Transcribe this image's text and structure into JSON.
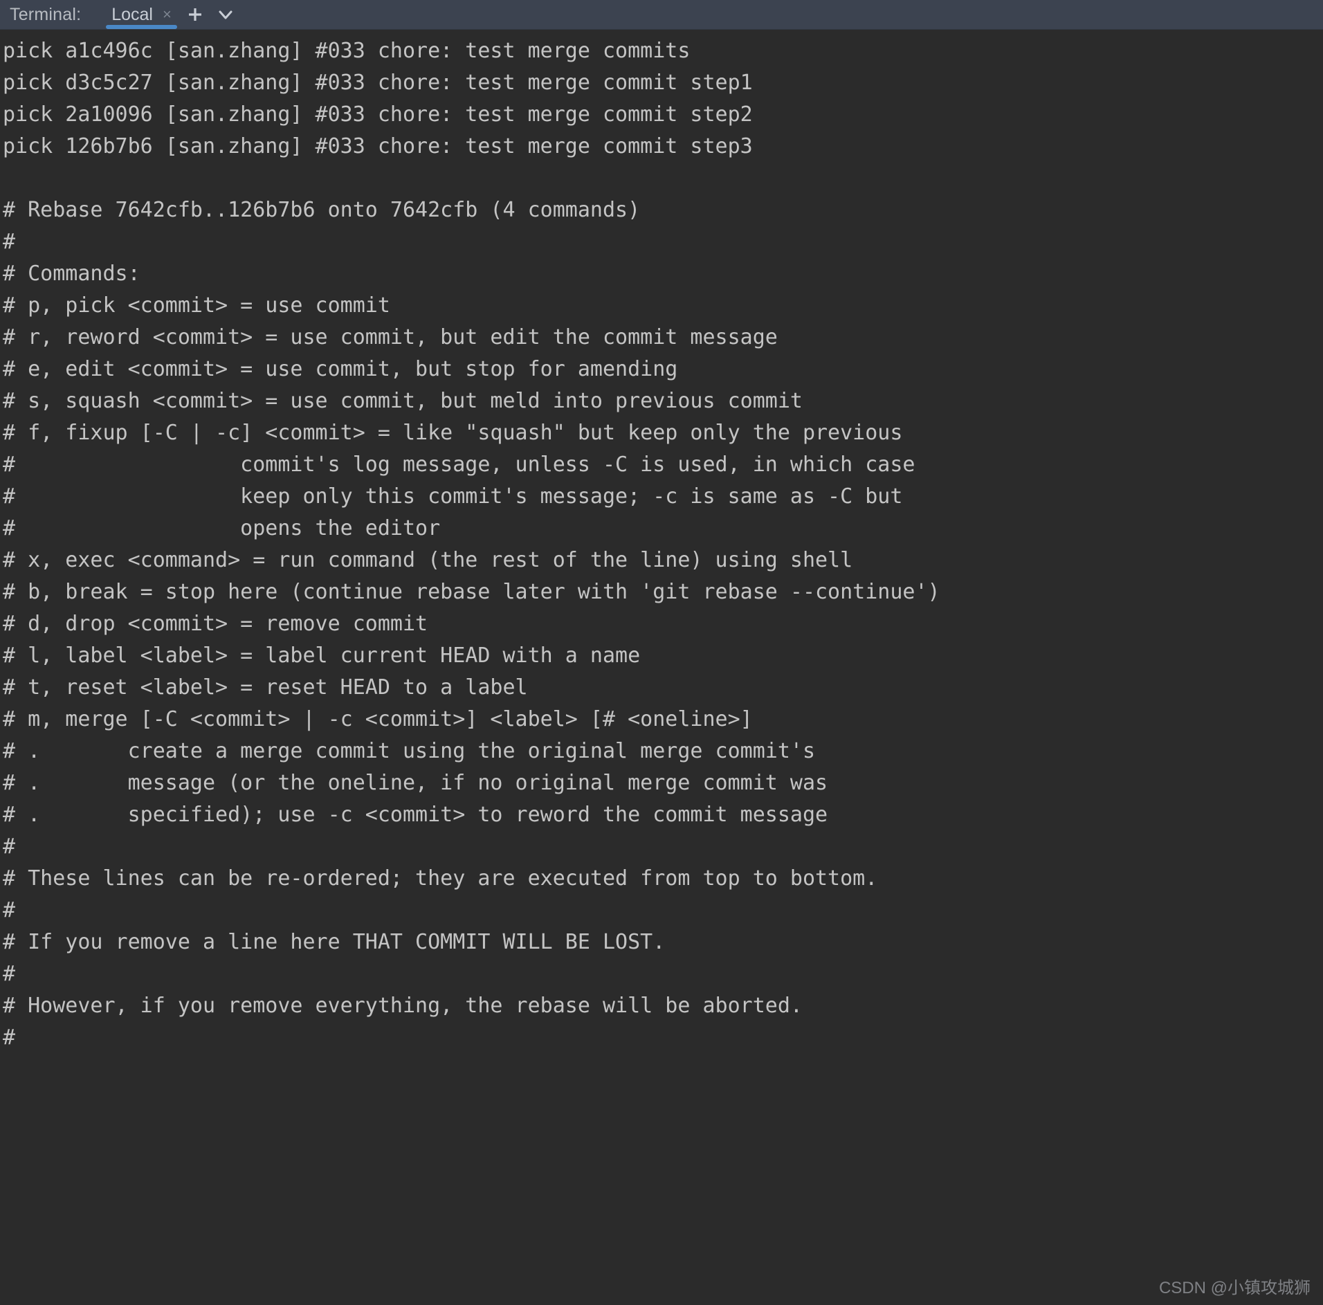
{
  "window": {
    "background_color": "#2b2b2b",
    "header_background_color": "#3c4350",
    "accent_color": "#4a88c7",
    "text_color": "#c4c4c4"
  },
  "header": {
    "label": "Terminal:",
    "tabs": [
      {
        "label": "Local",
        "close_label": "×",
        "active": true
      }
    ],
    "new_tab_icon": "plus-icon",
    "dropdown_icon": "chevron-down-icon"
  },
  "terminal": {
    "lines": [
      "pick a1c496c [san.zhang] #033 chore: test merge commits",
      "pick d3c5c27 [san.zhang] #033 chore: test merge commit step1",
      "pick 2a10096 [san.zhang] #033 chore: test merge commit step2",
      "pick 126b7b6 [san.zhang] #033 chore: test merge commit step3",
      "",
      "# Rebase 7642cfb..126b7b6 onto 7642cfb (4 commands)",
      "#",
      "# Commands:",
      "# p, pick <commit> = use commit",
      "# r, reword <commit> = use commit, but edit the commit message",
      "# e, edit <commit> = use commit, but stop for amending",
      "# s, squash <commit> = use commit, but meld into previous commit",
      "# f, fixup [-C | -c] <commit> = like \"squash\" but keep only the previous",
      "#                  commit's log message, unless -C is used, in which case",
      "#                  keep only this commit's message; -c is same as -C but",
      "#                  opens the editor",
      "# x, exec <command> = run command (the rest of the line) using shell",
      "# b, break = stop here (continue rebase later with 'git rebase --continue')",
      "# d, drop <commit> = remove commit",
      "# l, label <label> = label current HEAD with a name",
      "# t, reset <label> = reset HEAD to a label",
      "# m, merge [-C <commit> | -c <commit>] <label> [# <oneline>]",
      "# .       create a merge commit using the original merge commit's",
      "# .       message (or the oneline, if no original merge commit was",
      "# .       specified); use -c <commit> to reword the commit message",
      "#",
      "# These lines can be re-ordered; they are executed from top to bottom.",
      "#",
      "# If you remove a line here THAT COMMIT WILL BE LOST.",
      "#",
      "# However, if you remove everything, the rebase will be aborted.",
      "#"
    ]
  },
  "watermark": {
    "text": "CSDN @小镇攻城狮"
  }
}
